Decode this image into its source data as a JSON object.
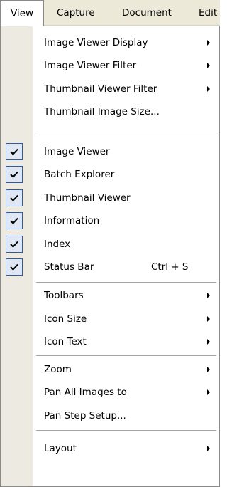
{
  "menubar": {
    "items": [
      {
        "label": "View"
      },
      {
        "label": "Capture"
      },
      {
        "label": "Document"
      },
      {
        "label": "Edit"
      }
    ]
  },
  "menu": {
    "items": [
      {
        "label": "Image Viewer Display",
        "submenu": true
      },
      {
        "label": "Image Viewer Filter",
        "submenu": true
      },
      {
        "label": "Thumbnail Viewer Filter",
        "submenu": true
      },
      {
        "label": "Thumbnail Image Size..."
      },
      {
        "label": "Image Viewer",
        "checked": true
      },
      {
        "label": "Batch Explorer",
        "checked": true
      },
      {
        "label": "Thumbnail Viewer",
        "checked": true
      },
      {
        "label": "Information",
        "checked": true
      },
      {
        "label": "Index",
        "checked": true
      },
      {
        "label": "Status Bar",
        "checked": true,
        "shortcut": "Ctrl + S"
      },
      {
        "label": "Toolbars",
        "submenu": true
      },
      {
        "label": "Icon Size",
        "submenu": true
      },
      {
        "label": "Icon Text",
        "submenu": true
      },
      {
        "label": "Zoom",
        "submenu": true
      },
      {
        "label": "Pan All Images to",
        "submenu": true
      },
      {
        "label": "Pan Step Setup..."
      },
      {
        "label": "Layout",
        "submenu": true
      }
    ]
  },
  "colors": {
    "menubar_bg": "#ece9d8",
    "gutter_bg": "#edeae1",
    "check_border": "#315a9c",
    "check_fill": "#dfe7f5"
  }
}
